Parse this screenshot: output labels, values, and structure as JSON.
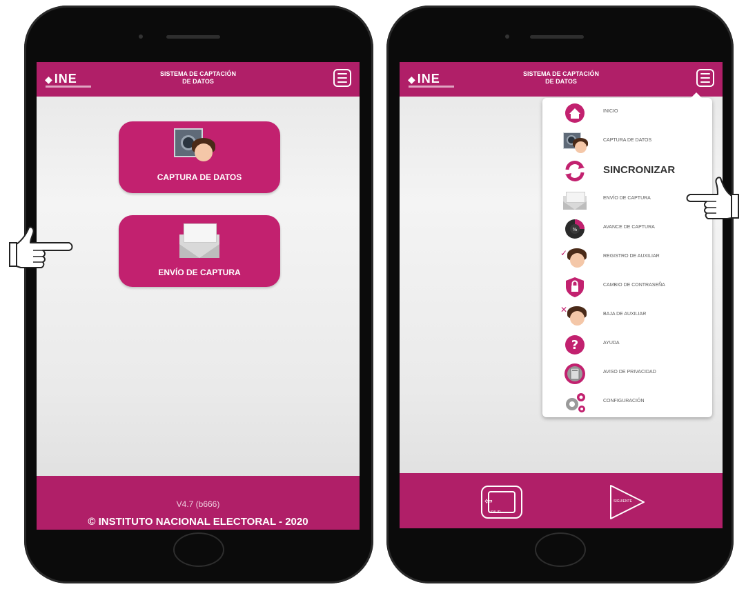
{
  "left_phone": {
    "header": {
      "logo": "INE",
      "title_line1": "SISTEMA DE CAPTACIÓN",
      "title_line2": "DE DATOS",
      "menu_icon": "hamburger-icon"
    },
    "buttons": [
      {
        "label": "CAPTURA DE DATOS",
        "icon": "camera-face-icon"
      },
      {
        "label": "ENVÍO DE CAPTURA",
        "icon": "envelope-icon"
      }
    ],
    "footer": {
      "version": "V4.7 (b666)",
      "copyright": "© INSTITUTO NACIONAL ELECTORAL - 2020"
    }
  },
  "right_phone": {
    "header": {
      "logo": "INE",
      "title_line1": "SISTEMA DE CAPTACIÓN",
      "title_line2": "DE DATOS",
      "menu_icon": "hamburger-icon"
    },
    "menu": [
      {
        "label": "INICIO",
        "icon": "home-icon"
      },
      {
        "label": "CAPTURA DE DATOS",
        "icon": "camera-face-icon"
      },
      {
        "label": "SINCRONIZAR",
        "icon": "sync-icon"
      },
      {
        "label": "ENVÍO DE CAPTURA",
        "icon": "envelope-icon"
      },
      {
        "label": "AVANCE DE CAPTURA",
        "icon": "progress-icon"
      },
      {
        "label": "REGISTRO DE AUXILIAR",
        "icon": "register-assistant-icon"
      },
      {
        "label": "CAMBIO DE CONTRASEÑA",
        "icon": "lock-shield-icon"
      },
      {
        "label": "BAJA DE AUXILIAR",
        "icon": "remove-assistant-icon"
      },
      {
        "label": "AYUDA",
        "icon": "help-icon"
      },
      {
        "label": "AVISO DE PRIVACIDAD",
        "icon": "privacy-icon"
      },
      {
        "label": "CONFIGURACIÓN",
        "icon": "gears-icon"
      }
    ],
    "footer": {
      "exit_label": "SALIR",
      "next_label": "SIGUIENTE"
    }
  },
  "colors": {
    "brand_magenta": "#b01f68",
    "button_magenta": "#c2216f"
  }
}
